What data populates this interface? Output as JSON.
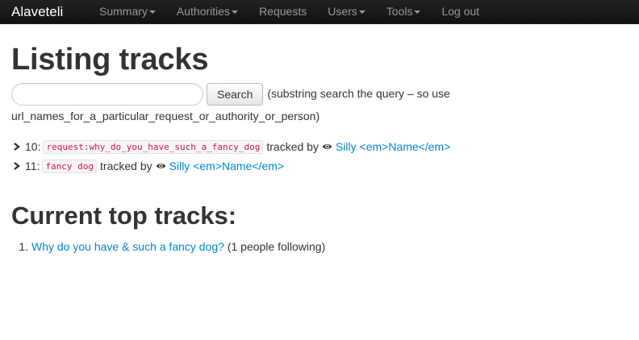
{
  "navbar": {
    "brand": "Alaveteli",
    "items": [
      {
        "label": "Summary",
        "dropdown": true
      },
      {
        "label": "Authorities",
        "dropdown": true
      },
      {
        "label": "Requests",
        "dropdown": false
      },
      {
        "label": "Users",
        "dropdown": true
      },
      {
        "label": "Tools",
        "dropdown": true
      },
      {
        "label": "Log out",
        "dropdown": false
      }
    ]
  },
  "page": {
    "title": "Listing tracks",
    "search": {
      "value": "",
      "placeholder": "",
      "button_label": "Search",
      "hint_inline": "(substring search the query – so use",
      "hint_line2": "url_names_for_a_particular_request_or_authority_or_person)"
    },
    "tracks": [
      {
        "id_label": "10:",
        "query": "request:why_do_you_have_such_a_fancy_dog",
        "tracked_by": "tracked by",
        "user": "Silly <em>Name</em>"
      },
      {
        "id_label": "11:",
        "query": "fancy dog",
        "tracked_by": "tracked by",
        "user": "Silly <em>Name</em>"
      }
    ],
    "top_tracks_heading": "Current top tracks:",
    "top_tracks": [
      {
        "link": "Why do you have & such a fancy dog?",
        "count_text": "(1 people following)"
      }
    ]
  },
  "colors": {
    "navbar_bg": "#1b1b1b",
    "link": "#0088cc",
    "code_text": "#dd1144"
  },
  "icons": {
    "track_bullet": "chevron-right-icon",
    "user": "eye-icon"
  }
}
